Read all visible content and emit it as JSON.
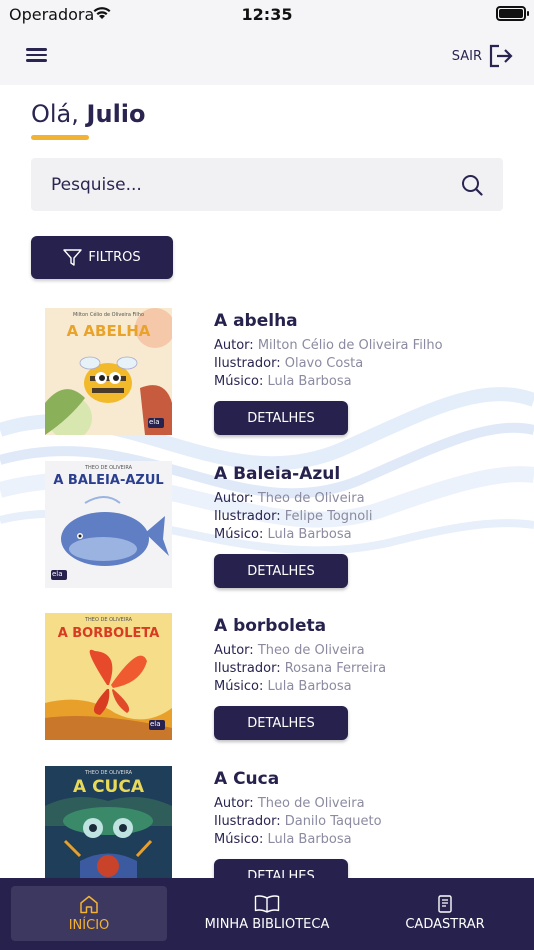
{
  "status_bar": {
    "carrier": "Operadora",
    "time": "12:35"
  },
  "header": {
    "logout_label": "SAIR"
  },
  "greeting": {
    "prefix": "Olá,",
    "name": "Julio"
  },
  "search": {
    "placeholder": "Pesquise..."
  },
  "filters": {
    "label": "FILTROS"
  },
  "labels": {
    "author": "Autor:",
    "illustrator": "Ilustrador:",
    "musician": "Músico:",
    "details": "DETALHES"
  },
  "books": [
    {
      "title": "A abelha",
      "author": "Milton Célio de Oliveira Filho",
      "illustrator": "Olavo Costa",
      "musician": "Lula Barbosa",
      "cover": {
        "title": "A ABELHA",
        "author": "Milton Célio de Oliveira Filho",
        "publisher": "ela"
      }
    },
    {
      "title": "A Baleia-Azul",
      "author": "Theo de Oliveira",
      "illustrator": "Felipe Tognoli",
      "musician": "Lula Barbosa",
      "cover": {
        "title": "A BALEIA-AZUL",
        "author": "THEO DE OLIVEIRA",
        "publisher": "ela"
      }
    },
    {
      "title": "A borboleta",
      "author": "Theo de Oliveira",
      "illustrator": "Rosana Ferreira",
      "musician": "Lula Barbosa",
      "cover": {
        "title": "A BORBOLETA",
        "author": "THEO DE OLIVEIRA",
        "publisher": "ela"
      }
    },
    {
      "title": "A Cuca",
      "author": "Theo de Oliveira",
      "illustrator": "Danilo Taqueto",
      "musician": "Lula Barbosa",
      "cover": {
        "title": "A CUCA",
        "author": "THEO DE OLIVEIRA",
        "publisher": "ela"
      }
    }
  ],
  "nav": {
    "home": {
      "label": "INÍCIO",
      "icon": "home-icon"
    },
    "library": {
      "label": "MINHA BIBLIOTECA",
      "icon": "book-open-icon"
    },
    "register": {
      "label": "CADASTRAR",
      "icon": "document-icon"
    }
  },
  "colors": {
    "primary": "#27224d",
    "accent": "#f2b233",
    "muted": "#8b8aa0"
  }
}
